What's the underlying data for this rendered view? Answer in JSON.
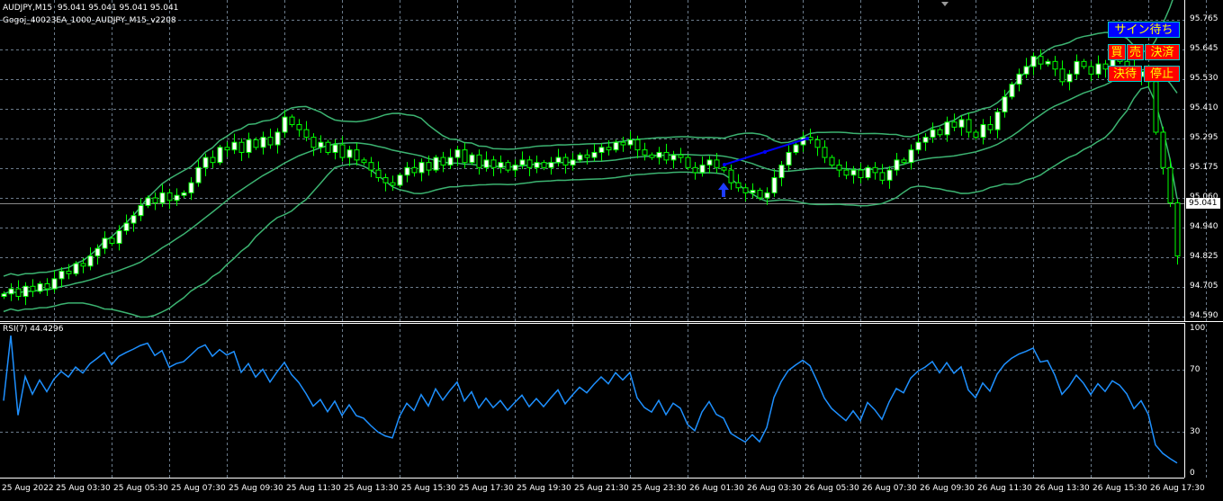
{
  "header": {
    "symbol_line": "AUDJPY,M15  95.041 95.041 95.041 95.041",
    "ea_name": "Gogoj_40023EA_1000_AUDJPY_M15_v2208"
  },
  "buttons": {
    "signal_wait": "サイン待ち",
    "buy": "買",
    "sell": "売",
    "settle": "決済",
    "settle_wait": "決待",
    "stop": "停止"
  },
  "price_axis": [
    "95.765",
    "95.645",
    "95.530",
    "95.410",
    "95.295",
    "95.175",
    "95.060",
    "94.940",
    "94.825",
    "94.705",
    "94.590"
  ],
  "current_price": "95.041",
  "rsi": {
    "label": "RSI(7) 44.4296",
    "axis": [
      "100",
      "70",
      "30",
      "0"
    ]
  },
  "time_axis": [
    "25 Aug 2022",
    "25 Aug 03:30",
    "25 Aug 05:30",
    "25 Aug 07:30",
    "25 Aug 09:30",
    "25 Aug 11:30",
    "25 Aug 13:30",
    "25 Aug 15:30",
    "25 Aug 17:30",
    "25 Aug 19:30",
    "25 Aug 21:30",
    "25 Aug 23:30",
    "26 Aug 01:30",
    "26 Aug 03:30",
    "26 Aug 05:30",
    "26 Aug 07:30",
    "26 Aug 09:30",
    "26 Aug 11:30",
    "26 Aug 13:30",
    "26 Aug 15:30",
    "26 Aug 17:30"
  ],
  "colors": {
    "bull": "#ffffff",
    "candle_outline": "#00ff00",
    "bands": "#3cb371",
    "rsi_line": "#1e90ff",
    "trendline": "#0000ff",
    "grid": "#6b7b8b"
  },
  "series": {
    "closes": [
      94.68,
      94.7,
      94.67,
      94.71,
      94.69,
      94.72,
      94.7,
      94.74,
      94.77,
      94.76,
      94.8,
      94.79,
      94.83,
      94.86,
      94.9,
      94.88,
      94.93,
      94.96,
      94.99,
      95.03,
      95.06,
      95.04,
      95.08,
      95.05,
      95.07,
      95.08,
      95.12,
      95.18,
      95.22,
      95.2,
      95.26,
      95.25,
      95.28,
      95.24,
      95.29,
      95.26,
      95.3,
      95.27,
      95.32,
      95.38,
      95.35,
      95.33,
      95.3,
      95.26,
      95.28,
      95.24,
      95.27,
      95.22,
      95.25,
      95.21,
      95.2,
      95.17,
      95.14,
      95.12,
      95.11,
      95.15,
      95.18,
      95.16,
      95.2,
      95.17,
      95.22,
      95.19,
      95.22,
      95.25,
      95.2,
      95.23,
      95.18,
      95.21,
      95.18,
      95.2,
      95.17,
      95.19,
      95.21,
      95.18,
      95.2,
      95.18,
      95.2,
      95.22,
      95.19,
      95.21,
      95.23,
      95.22,
      95.24,
      95.26,
      95.25,
      95.28,
      95.27,
      95.29,
      95.25,
      95.23,
      95.22,
      95.24,
      95.21,
      95.23,
      95.22,
      95.18,
      95.16,
      95.19,
      95.21,
      95.18,
      95.17,
      95.12,
      95.1,
      95.08,
      95.09,
      95.06,
      95.08,
      95.14,
      95.19,
      95.24,
      95.27,
      95.3,
      95.29,
      95.26,
      95.22,
      95.19,
      95.17,
      95.15,
      95.17,
      95.14,
      95.18,
      95.16,
      95.13,
      95.17,
      95.21,
      95.2,
      95.25,
      95.28,
      95.3,
      95.33,
      95.31,
      95.36,
      95.34,
      95.37,
      95.32,
      95.3,
      95.35,
      95.33,
      95.4,
      95.46,
      95.51,
      95.55,
      95.58,
      95.62,
      95.59,
      95.6,
      95.57,
      95.52,
      95.55,
      95.6,
      95.58,
      95.55,
      95.59,
      95.57,
      95.61,
      95.6,
      95.58,
      95.54,
      95.56,
      95.52,
      95.32,
      95.18,
      95.04,
      94.83
    ]
  }
}
